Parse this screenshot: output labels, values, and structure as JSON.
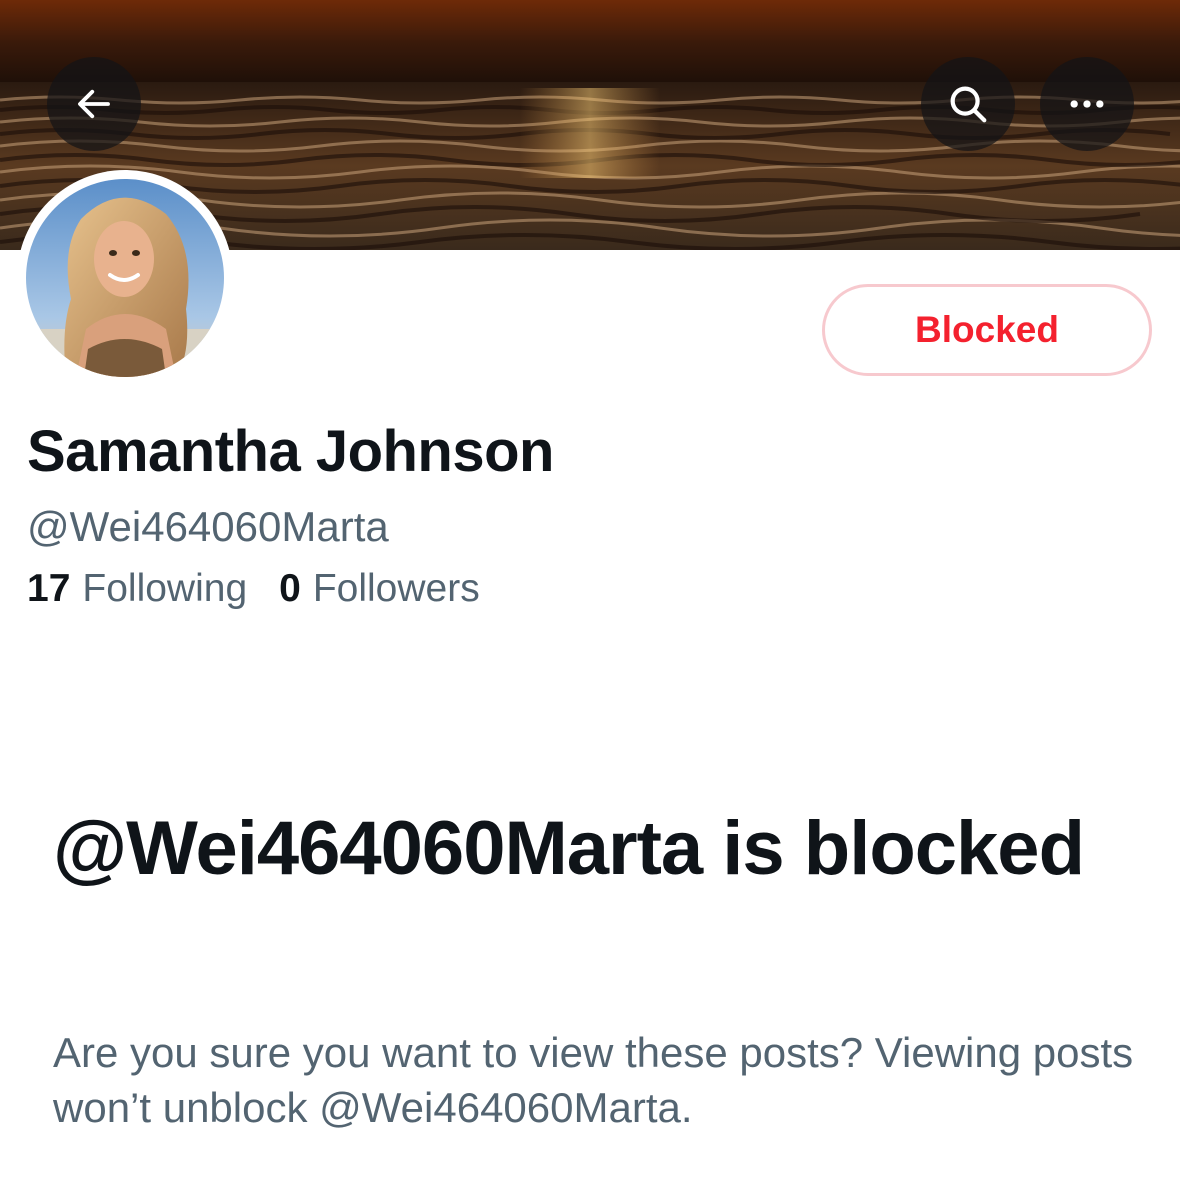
{
  "profile": {
    "display_name": "Samantha Johnson",
    "handle": "@Wei464060Marta",
    "following_count": "17",
    "following_label": "Following",
    "followers_count": "0",
    "followers_label": "Followers"
  },
  "actions": {
    "blocked_label": "Blocked"
  },
  "notice": {
    "heading": "@Wei464060Marta is blocked",
    "description": "Are you sure you want to view these posts? Viewing posts won’t unblock @Wei464060Marta."
  },
  "icons": {
    "back": "arrow-left-icon",
    "search": "search-icon",
    "more": "more-horizontal-icon"
  },
  "colors": {
    "blocked_red": "#f4212e",
    "blocked_border": "#f7c9ce",
    "secondary_text": "#536471",
    "primary_text": "#0f1419"
  }
}
